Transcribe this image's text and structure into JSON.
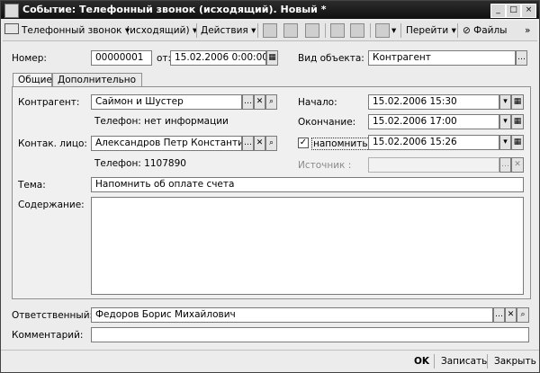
{
  "window": {
    "title": "Событие: Телефонный звонок (исходящий). Новый *"
  },
  "titlebar_buttons": [
    "_",
    "□",
    "×"
  ],
  "toolbar": {
    "event_type": "Телефонный звонок",
    "direction": "(исходящий)",
    "actions": "Действия",
    "goto": "Перейти",
    "files": "Файлы"
  },
  "header": {
    "number_label": "Номер:",
    "number_value": "00000001",
    "from_label": "от:",
    "date_value": "15.02.2006  0:00:00",
    "object_type_label": "Вид объекта:",
    "object_type_value": "Контрагент"
  },
  "tabs": [
    {
      "label": "Общие"
    },
    {
      "label": "Дополнительно"
    }
  ],
  "general": {
    "contractor_label": "Контрагент:",
    "contractor_value": "Саймон и Шустер",
    "contractor_phone": "Телефон: нет информации",
    "contact_label": "Контак. лицо:",
    "contact_value": "Александров Петр Константинович",
    "contact_phone": "Телефон: 1107890",
    "start_label": "Начало:",
    "start_value": "15.02.2006 15:30",
    "end_label": "Окончание:",
    "end_value": "15.02.2006 17:00",
    "remind_label": "напомнить",
    "remind_checked": "✓",
    "remind_value": "15.02.2006 15:26",
    "source_label": "Источник :",
    "source_value": "",
    "topic_label": "Тема:",
    "topic_value": "Напомнить об оплате счета",
    "content_label": "Содержание:",
    "content_value": ""
  },
  "footer": {
    "responsible_label": "Ответственный:",
    "responsible_value": "Федоров Борис Михайлович",
    "comment_label": "Комментарий:",
    "comment_value": ""
  },
  "buttons": {
    "ok": "OK",
    "save": "Записать",
    "close": "Закрыть"
  }
}
